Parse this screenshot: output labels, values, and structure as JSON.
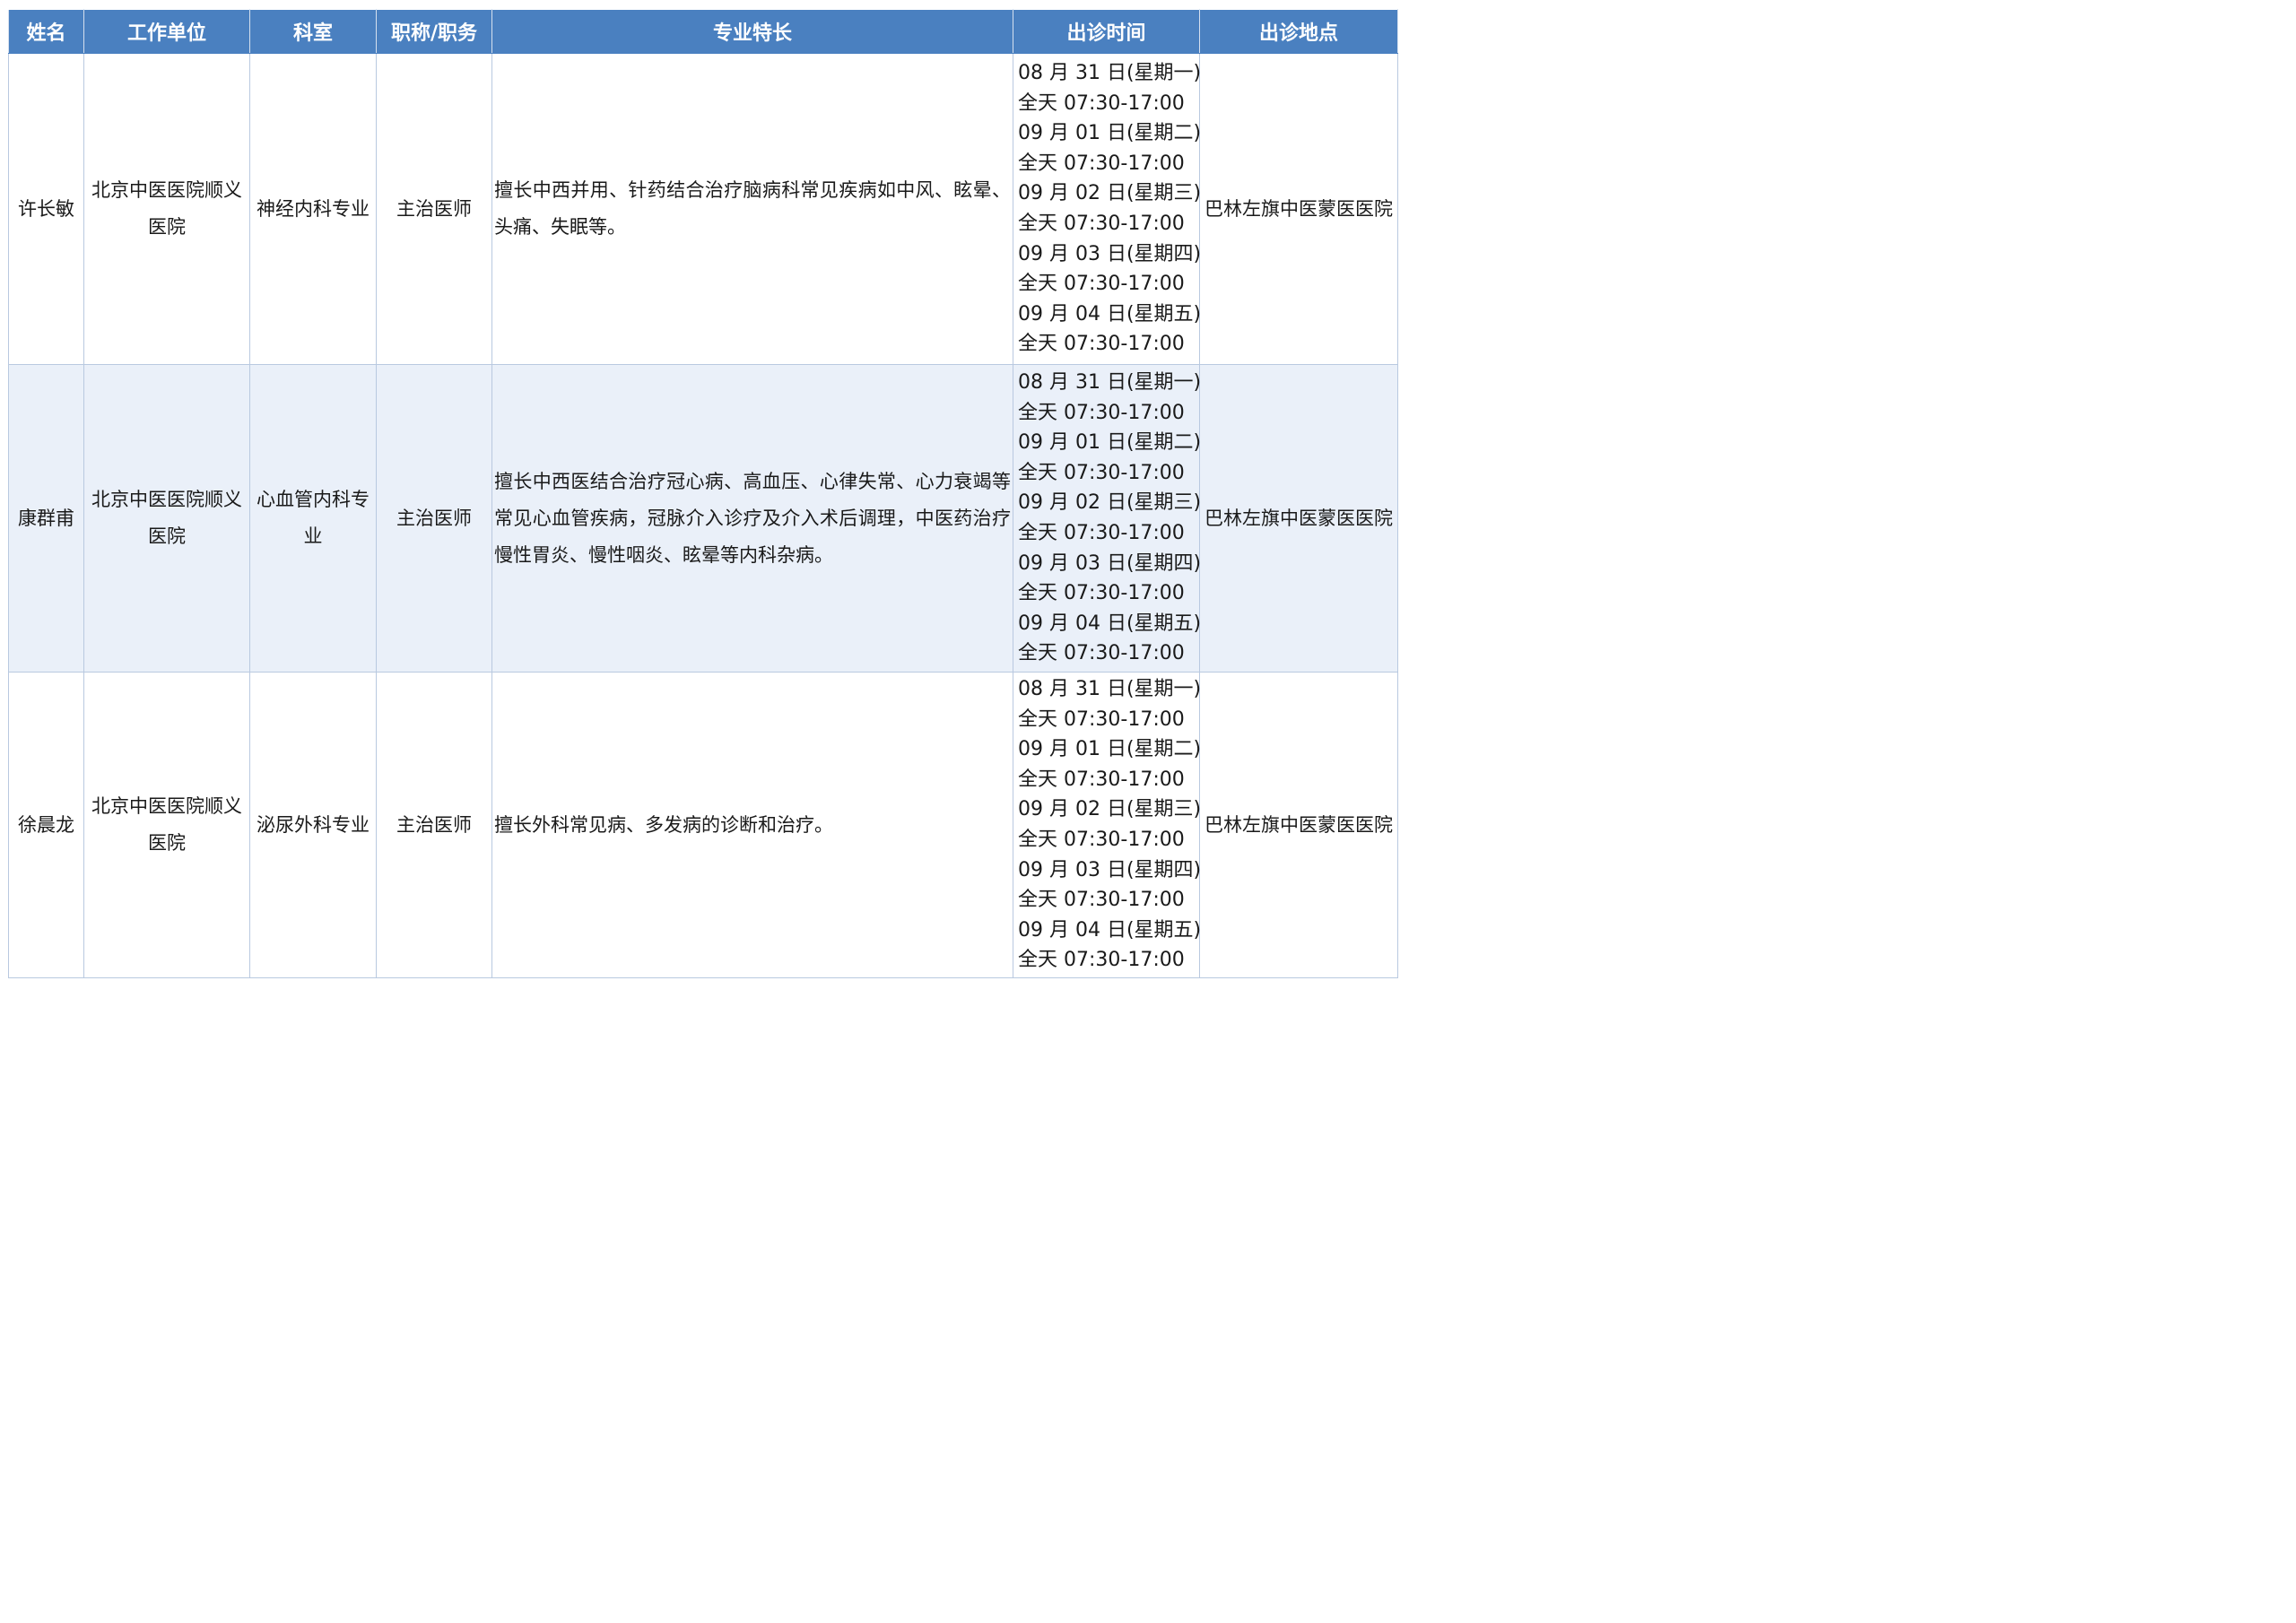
{
  "table": {
    "headers": [
      "姓名",
      "工作单位",
      "科室",
      "职称/职务",
      "专业特长",
      "出诊时间",
      "出诊地点"
    ],
    "rows": [
      {
        "name": "许长敏",
        "unit": "北京中医医院顺义医院",
        "department": "神经内科专业",
        "title": "主治医师",
        "specialty": "擅长中西并用、针药结合治疗脑病科常见疾病如中风、眩晕、头痛、失眠等。",
        "schedule": [
          "08 月 31 日(星期一)",
          "全天 07:30-17:00",
          "09 月 01 日(星期二)",
          "全天 07:30-17:00",
          "09 月 02 日(星期三)",
          "全天 07:30-17:00",
          "09 月 03 日(星期四)",
          "全天 07:30-17:00",
          "09 月 04 日(星期五)",
          "全天 07:30-17:00"
        ],
        "location": "巴林左旗中医蒙医医院"
      },
      {
        "name": "康群甫",
        "unit": "北京中医医院顺义医院",
        "department": "心血管内科专业",
        "title": "主治医师",
        "specialty": "擅长中西医结合治疗冠心病、高血压、心律失常、心力衰竭等常见心血管疾病，冠脉介入诊疗及介入术后调理，中医药治疗慢性胃炎、慢性咽炎、眩晕等内科杂病。",
        "schedule": [
          "08 月 31 日(星期一)",
          "全天 07:30-17:00",
          "09 月 01 日(星期二)",
          "全天 07:30-17:00",
          "09 月 02 日(星期三)",
          "全天 07:30-17:00",
          "09 月 03 日(星期四)",
          "全天 07:30-17:00",
          "09 月 04 日(星期五)",
          "全天 07:30-17:00"
        ],
        "location": "巴林左旗中医蒙医医院"
      },
      {
        "name": "徐晨龙",
        "unit": "北京中医医院顺义医院",
        "department": "泌尿外科专业",
        "title": "主治医师",
        "specialty": "擅长外科常见病、多发病的诊断和治疗。",
        "schedule": [
          "08 月 31 日(星期一)",
          "全天 07:30-17:00",
          "09 月 01 日(星期二)",
          "全天 07:30-17:00",
          "09 月 02 日(星期三)",
          "全天 07:30-17:00",
          "09 月 03 日(星期四)",
          "全天 07:30-17:00",
          "09 月 04 日(星期五)",
          "全天 07:30-17:00"
        ],
        "location": "巴林左旗中医蒙医医院"
      }
    ]
  },
  "colors": {
    "header_bg": "#4a80c0",
    "header_text": "#ffffff",
    "alt_row_bg": "#eaf0f9",
    "border": "#b9c9e0"
  }
}
